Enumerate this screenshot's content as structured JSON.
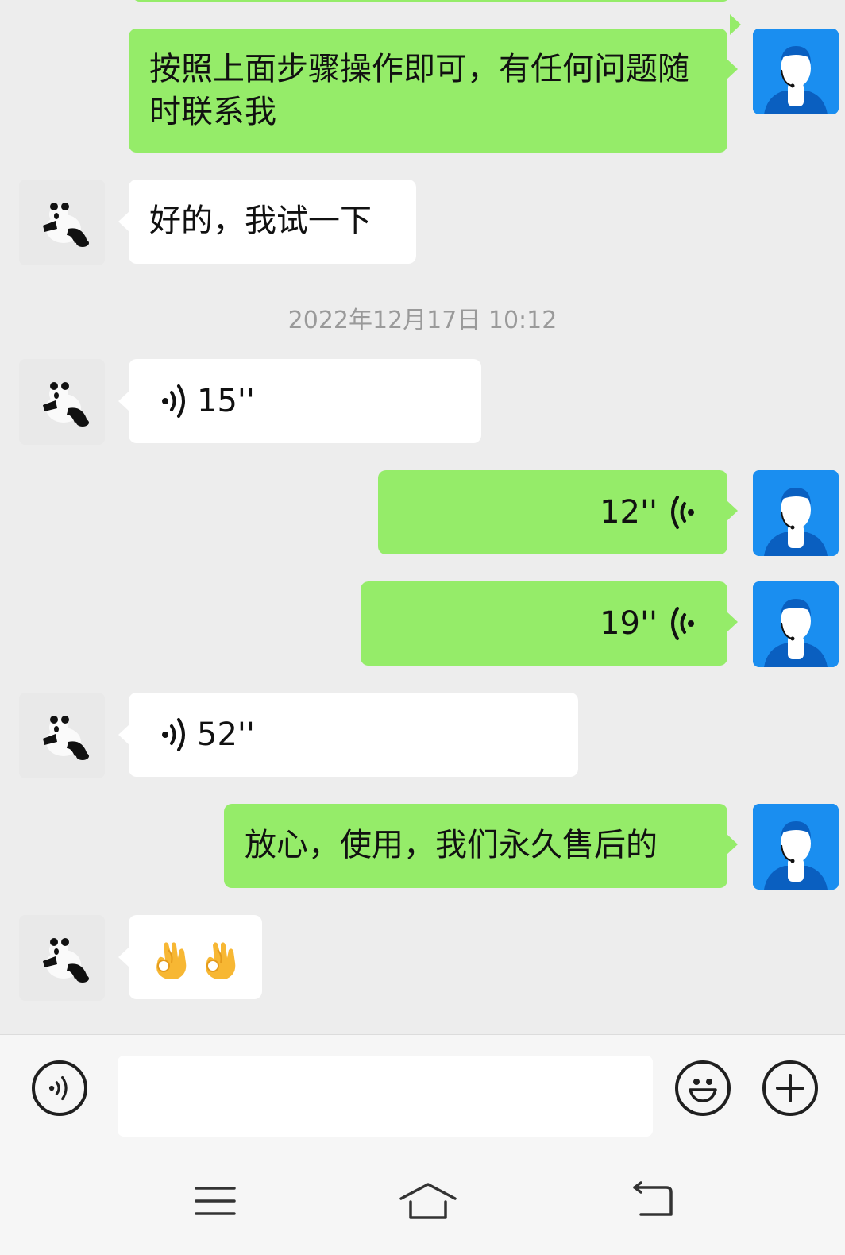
{
  "messages": [
    {
      "side": "me",
      "type": "text",
      "text": "按照上面步骤操作即可，有任何问题随时联系我"
    },
    {
      "side": "them",
      "type": "text",
      "text": "好的，我试一下"
    },
    {
      "type": "timestamp",
      "text": "2022年12月17日 10:12"
    },
    {
      "side": "them",
      "type": "voice",
      "duration": "15''"
    },
    {
      "side": "me",
      "type": "voice",
      "duration": "12''"
    },
    {
      "side": "me",
      "type": "voice",
      "duration": "19''"
    },
    {
      "side": "them",
      "type": "voice",
      "duration": "52''"
    },
    {
      "side": "me",
      "type": "text",
      "text": "放心，使用，我们永久售后的"
    },
    {
      "side": "them",
      "type": "emoji",
      "emoji": [
        "ok-hand-emoji",
        "ok-hand-emoji"
      ]
    }
  ],
  "input_bar": {
    "voice_toggle_icon": "voice-wave-icon",
    "text_value": "",
    "emoji_icon": "smiley-icon",
    "more_icon": "plus-icon"
  },
  "nav_bar": {
    "icons": [
      "menu-icon",
      "home-icon",
      "back-icon"
    ]
  },
  "colors": {
    "background": "#ededed",
    "my_bubble": "#95ec69",
    "their_bubble": "#ffffff",
    "my_avatar": "#1a8ef0",
    "timestamp": "#9a9a9a"
  }
}
